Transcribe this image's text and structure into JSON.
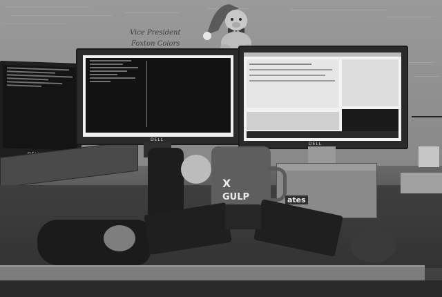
{
  "whiteboard": {
    "note_line1": "Vice   President",
    "note_line2": "Foxton Colors"
  },
  "left_monitor": {
    "brand": "DELL"
  },
  "right_monitor": {
    "brand": "DELL"
  },
  "laptop": {
    "brand": "DELL"
  },
  "cup": {
    "logo": "X",
    "name": "GULP"
  },
  "box": {
    "label": "ates"
  },
  "colors": {
    "wall": "#8a8a8a",
    "desk": "#3c3c3c",
    "screen_dark": "#111111",
    "screen_light": "#f2f2f2"
  }
}
